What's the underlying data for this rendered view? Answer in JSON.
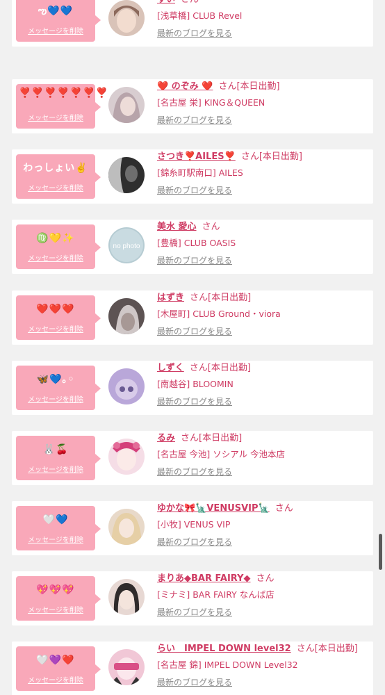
{
  "common": {
    "delete_label": "メッセージを削除",
    "blog_label": "最新のブログを見る",
    "avatar_no_photo": "no photo"
  },
  "cards": [
    {
      "stamp": "ఌ💙💙",
      "name": "すい",
      "suffix": "さん",
      "shop": "[浅草橋] CLUB Revel",
      "avatar_colors": [
        "#d9c3b8",
        "#8c6a5c"
      ]
    },
    {
      "stamp": "❣️❣️❣️❣️❣️❣️❣️",
      "name": "❤️ のぞみ ❤️",
      "suffix": "さん[本日出勤]",
      "shop": "[名古屋 栄] KING＆QUEEN",
      "avatar_colors": [
        "#d8cdd0",
        "#b7a4aa"
      ]
    },
    {
      "stamp": "わっしょい✌️",
      "name": "さつき❣️AILES❣️",
      "suffix": "さん[本日出勤]",
      "shop": "[錦糸町駅南口] AILES",
      "avatar_colors": [
        "#3a3a3a",
        "#b4b4b4"
      ]
    },
    {
      "stamp": "♍️💛✨",
      "name": "美水 愛心",
      "suffix": "さん",
      "shop": "[豊橋] CLUB OASIS",
      "avatar_colors": [
        "#a9c3cc",
        "#c9dbe1"
      ]
    },
    {
      "stamp": "❤️❤️❤️",
      "name": "はずき",
      "suffix": "さん[本日出勤]",
      "shop": "[木屋町] CLUB Ground・viora",
      "avatar_colors": [
        "#6b6060",
        "#cfc7c7"
      ]
    },
    {
      "stamp": "🦋💙｡◦",
      "name": "しずく",
      "suffix": "さん[本日出勤]",
      "shop": "[南越谷] BLOOMIN",
      "avatar_colors": [
        "#b9a7d9",
        "#7b6aa6"
      ]
    },
    {
      "stamp": "🐰🍒",
      "name": "るみ",
      "suffix": "さん[本日出勤]",
      "shop": "[名古屋 今池] ソシアル 今池本店",
      "avatar_colors": [
        "#e9b7c8",
        "#f5dde6"
      ]
    },
    {
      "stamp": "🤍💙",
      "name": "ゆかな🎀🗽VENUSVIP🗽",
      "suffix": "さん",
      "shop": "[小牧] VENUS VIP",
      "avatar_colors": [
        "#e8d9c9",
        "#c9a98f"
      ]
    },
    {
      "stamp": "💖💖💖",
      "name": "まりあ◆BAR FAIRY◆",
      "suffix": "さん",
      "shop": "[ミナミ] BAR FAIRY なんば店",
      "avatar_colors": [
        "#2f2b2b",
        "#e7d8d3"
      ]
    },
    {
      "stamp": "🤍💜❤️",
      "name": "らい　IMPEL DOWN level32",
      "suffix": "さん[本日出勤]",
      "shop": "[名古屋 錦] IMPEL DOWN Level32",
      "avatar_colors": [
        "#f1c7d6",
        "#d94f86"
      ]
    }
  ]
}
